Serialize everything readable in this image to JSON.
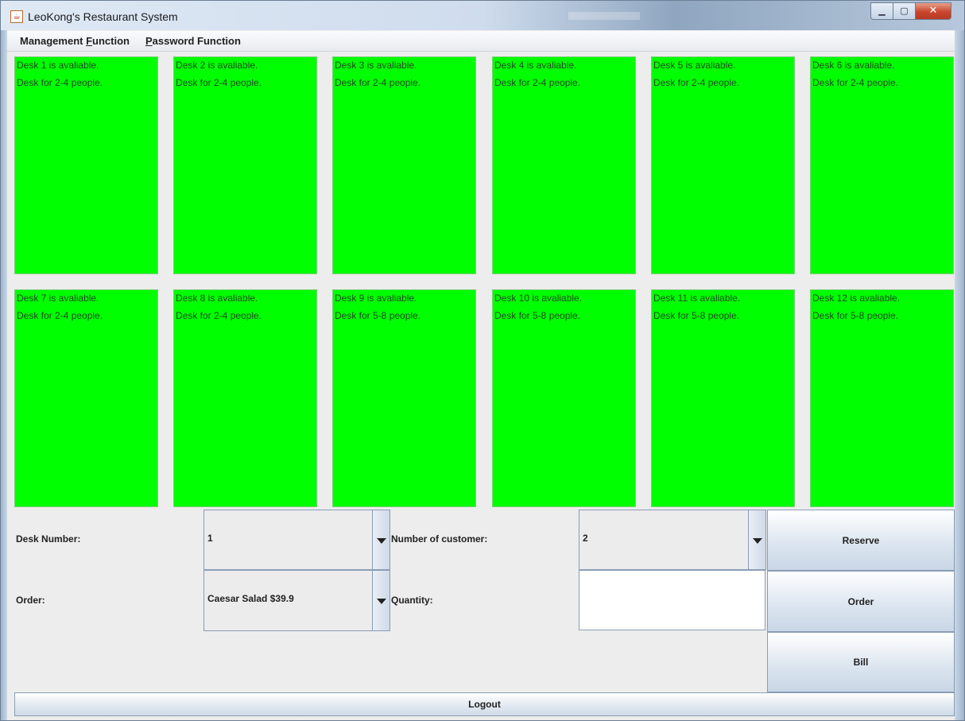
{
  "window": {
    "title": "LeoKong's Restaurant System"
  },
  "menu": [
    {
      "pre": "Management ",
      "mn": "F",
      "post": "unction"
    },
    {
      "pre": "",
      "mn": "P",
      "post": "assword Function"
    }
  ],
  "desks": [
    {
      "status": "Desk 1 is avaliable.",
      "capacity": "Desk for 2-4 people."
    },
    {
      "status": "Desk 2 is avaliable.",
      "capacity": "Desk for 2-4 people."
    },
    {
      "status": "Desk 3 is avaliable.",
      "capacity": "Desk for 2-4 people."
    },
    {
      "status": "Desk 4 is avaliable.",
      "capacity": "Desk for 2-4 people."
    },
    {
      "status": "Desk 5 is avaliable.",
      "capacity": "Desk for 2-4 people."
    },
    {
      "status": "Desk 6 is avaliable.",
      "capacity": "Desk for 2-4 people."
    },
    {
      "status": "Desk 7 is avaliable.",
      "capacity": "Desk for 2-4 people."
    },
    {
      "status": "Desk 8 is avaliable.",
      "capacity": "Desk for 2-4 people."
    },
    {
      "status": "Desk 9 is avaliable.",
      "capacity": "Desk for 5-8 people."
    },
    {
      "status": "Desk 10 is avaliable.",
      "capacity": "Desk for 5-8 people."
    },
    {
      "status": "Desk 11 is avaliable.",
      "capacity": "Desk for 5-8 people."
    },
    {
      "status": "Desk 12 is avaliable.",
      "capacity": "Desk for 5-8 people."
    }
  ],
  "form": {
    "desk_number_label": "Desk Number:",
    "desk_number_value": "1",
    "customers_label": "Number of customer:",
    "customers_value": "2",
    "order_label": "Order:",
    "order_value": "Caesar Salad $39.9",
    "quantity_label": "Quantity:",
    "quantity_value": ""
  },
  "buttons": {
    "reserve": "Reserve",
    "order": "Order",
    "bill": "Bill",
    "logout": "Logout"
  },
  "colors": {
    "desk_available": "#00ff00"
  }
}
